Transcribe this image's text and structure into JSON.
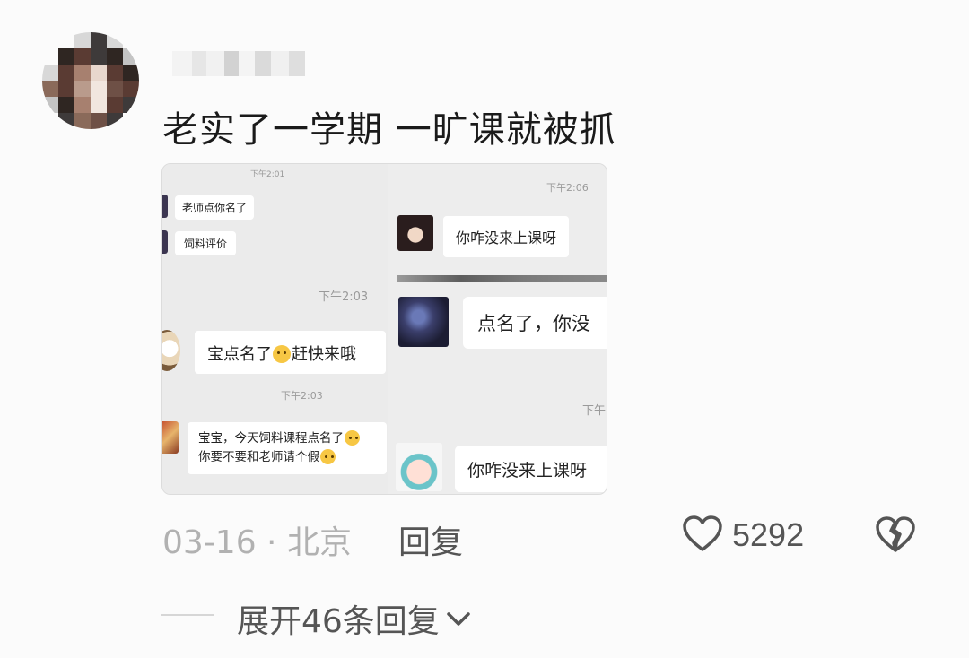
{
  "comment": {
    "text": "老实了一学期 一旷课就被抓",
    "date_location": "03-16 · 北京",
    "reply_label": "回复",
    "like_count": "5292",
    "expand_label": "展开46条回复"
  },
  "screenshot": {
    "left": {
      "ts1": "下午2:01",
      "msg1": "老师点你名了",
      "msg2": "饲料评价",
      "ts2": "下午2:03",
      "msg3_a": "宝点名了",
      "msg3_b": "赶快来哦",
      "ts3": "下午2:03",
      "msg4_line1": "宝宝，今天饲料课程点名了",
      "msg4_line2": "你要不要和老师请个假"
    },
    "right": {
      "ts1": "下午2:06",
      "msg1": "你咋没来上课呀",
      "msg2": "点名了，你没",
      "ts2": "下午",
      "msg3": "你咋没来上课呀"
    }
  },
  "icons": {
    "like": "heart-outline-icon",
    "dislike": "broken-heart-icon",
    "expand": "chevron-down-icon"
  },
  "colors": {
    "background": "#fbfbfb",
    "meta_text": "#b1b1b1",
    "action_text": "#555555"
  }
}
